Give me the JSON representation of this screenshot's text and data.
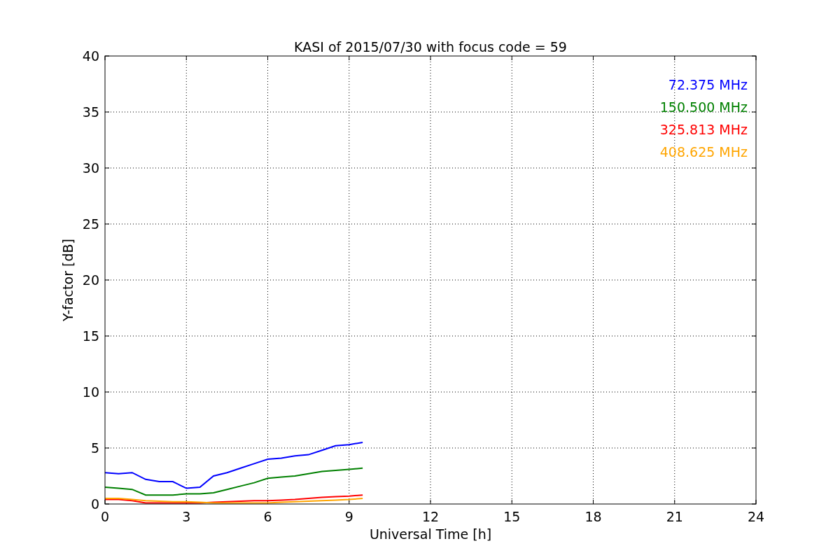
{
  "chart_data": {
    "type": "line",
    "title": "KASI of 2015/07/30 with focus code = 59",
    "xlabel": "Universal Time [h]",
    "ylabel": "Y-factor [dB]",
    "x": [
      0,
      0.5,
      1,
      1.5,
      2,
      2.5,
      3,
      3.5,
      4,
      4.5,
      5,
      5.5,
      6,
      6.5,
      7,
      7.5,
      8,
      8.5,
      9,
      9.5
    ],
    "series": [
      {
        "name": "72.375 MHz",
        "color": "#0000ff",
        "values": [
          2.8,
          2.7,
          2.8,
          2.2,
          2.0,
          2.0,
          1.4,
          1.5,
          2.5,
          2.8,
          3.2,
          3.6,
          4.0,
          4.1,
          4.3,
          4.4,
          4.8,
          5.2,
          5.3,
          5.5
        ]
      },
      {
        "name": "150.500 MHz",
        "color": "#008000",
        "values": [
          1.5,
          1.4,
          1.3,
          0.8,
          0.8,
          0.8,
          0.9,
          0.9,
          1.0,
          1.3,
          1.6,
          1.9,
          2.3,
          2.4,
          2.5,
          2.7,
          2.9,
          3.0,
          3.1,
          3.2
        ]
      },
      {
        "name": "325.813 MHz",
        "color": "#ff0000",
        "values": [
          0.4,
          0.4,
          0.3,
          0.1,
          0.1,
          0.1,
          0.1,
          0.1,
          0.15,
          0.2,
          0.25,
          0.3,
          0.3,
          0.35,
          0.4,
          0.5,
          0.6,
          0.65,
          0.7,
          0.8
        ]
      },
      {
        "name": "408.625 MHz",
        "color": "#ffa500",
        "values": [
          0.5,
          0.5,
          0.4,
          0.3,
          0.25,
          0.2,
          0.2,
          0.15,
          0.1,
          0.1,
          0.1,
          0.1,
          0.1,
          0.15,
          0.2,
          0.25,
          0.3,
          0.35,
          0.4,
          0.5
        ]
      }
    ],
    "xlim": [
      0,
      24
    ],
    "ylim": [
      0,
      40
    ],
    "xticks": [
      0,
      3,
      6,
      9,
      12,
      15,
      18,
      21,
      24
    ],
    "yticks": [
      0,
      5,
      10,
      15,
      20,
      25,
      30,
      35,
      40
    ],
    "grid": true
  }
}
